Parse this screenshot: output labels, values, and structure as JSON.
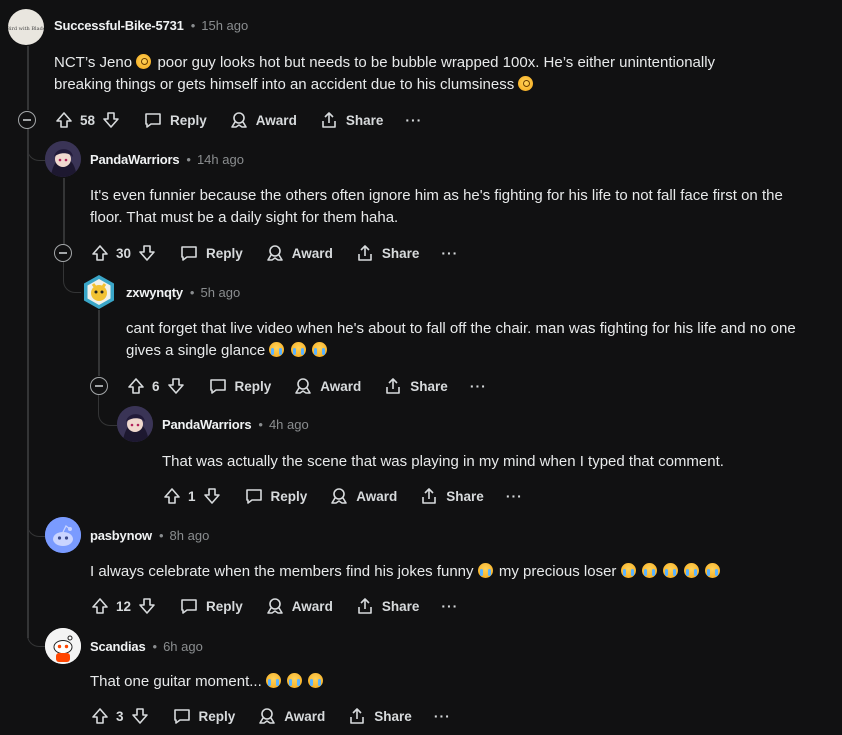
{
  "icons": {
    "upvote": "arrow-up-icon",
    "downvote": "arrow-down-icon",
    "reply": "comment-bubble-icon",
    "award": "award-icon",
    "share": "share-icon",
    "more": "ellipsis-icon",
    "collapse": "collapse-minus-icon"
  },
  "labels": {
    "reply": "Reply",
    "award": "Award",
    "share": "Share",
    "more": "···"
  },
  "comments": [
    {
      "author": "Successful-Bike-5731",
      "time": "15h ago",
      "text_1": "NCT’s Jeno",
      "text_2": "poor guy looks hot but needs to be bubble wrapped 100x. He’s either unintentionally breaking things or gets himself into an accident due to his clumsiness",
      "score": "58"
    },
    {
      "author": "PandaWarriors",
      "time": "14h ago",
      "text": "It's even funnier because the others often ignore him as he's fighting for his life to not fall face first on the floor. That must be a daily sight for them haha.",
      "score": "30"
    },
    {
      "author": "zxwynqty",
      "time": "5h ago",
      "text": "cant forget that live video when he's about to fall off the chair. man was fighting for his life and no one gives a single glance",
      "score": "6"
    },
    {
      "author": "PandaWarriors",
      "time": "4h ago",
      "text": "That was actually the scene that was playing in my mind when I typed that comment.",
      "score": "1"
    },
    {
      "author": "pasbynow",
      "time": "8h ago",
      "text_1": "I always celebrate when the members find his jokes funny",
      "text_2": "my precious loser",
      "score": "12"
    },
    {
      "author": "Scandias",
      "time": "6h ago",
      "text": "That one guitar moment...",
      "score": "3"
    }
  ],
  "colors": {
    "background": "#111112",
    "text": "#d7dadc",
    "muted": "#8a8d8f",
    "thread_line": "#343536"
  }
}
